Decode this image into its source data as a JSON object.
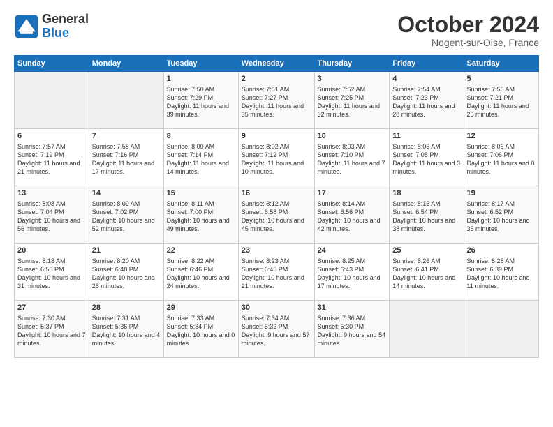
{
  "header": {
    "logo_line1": "General",
    "logo_line2": "Blue",
    "month": "October 2024",
    "location": "Nogent-sur-Oise, France"
  },
  "columns": [
    "Sunday",
    "Monday",
    "Tuesday",
    "Wednesday",
    "Thursday",
    "Friday",
    "Saturday"
  ],
  "rows": [
    [
      {
        "day": "",
        "info": ""
      },
      {
        "day": "",
        "info": ""
      },
      {
        "day": "1",
        "info": "Sunrise: 7:50 AM\nSunset: 7:29 PM\nDaylight: 11 hours and 39 minutes."
      },
      {
        "day": "2",
        "info": "Sunrise: 7:51 AM\nSunset: 7:27 PM\nDaylight: 11 hours and 35 minutes."
      },
      {
        "day": "3",
        "info": "Sunrise: 7:52 AM\nSunset: 7:25 PM\nDaylight: 11 hours and 32 minutes."
      },
      {
        "day": "4",
        "info": "Sunrise: 7:54 AM\nSunset: 7:23 PM\nDaylight: 11 hours and 28 minutes."
      },
      {
        "day": "5",
        "info": "Sunrise: 7:55 AM\nSunset: 7:21 PM\nDaylight: 11 hours and 25 minutes."
      }
    ],
    [
      {
        "day": "6",
        "info": "Sunrise: 7:57 AM\nSunset: 7:19 PM\nDaylight: 11 hours and 21 minutes."
      },
      {
        "day": "7",
        "info": "Sunrise: 7:58 AM\nSunset: 7:16 PM\nDaylight: 11 hours and 17 minutes."
      },
      {
        "day": "8",
        "info": "Sunrise: 8:00 AM\nSunset: 7:14 PM\nDaylight: 11 hours and 14 minutes."
      },
      {
        "day": "9",
        "info": "Sunrise: 8:02 AM\nSunset: 7:12 PM\nDaylight: 11 hours and 10 minutes."
      },
      {
        "day": "10",
        "info": "Sunrise: 8:03 AM\nSunset: 7:10 PM\nDaylight: 11 hours and 7 minutes."
      },
      {
        "day": "11",
        "info": "Sunrise: 8:05 AM\nSunset: 7:08 PM\nDaylight: 11 hours and 3 minutes."
      },
      {
        "day": "12",
        "info": "Sunrise: 8:06 AM\nSunset: 7:06 PM\nDaylight: 11 hours and 0 minutes."
      }
    ],
    [
      {
        "day": "13",
        "info": "Sunrise: 8:08 AM\nSunset: 7:04 PM\nDaylight: 10 hours and 56 minutes."
      },
      {
        "day": "14",
        "info": "Sunrise: 8:09 AM\nSunset: 7:02 PM\nDaylight: 10 hours and 52 minutes."
      },
      {
        "day": "15",
        "info": "Sunrise: 8:11 AM\nSunset: 7:00 PM\nDaylight: 10 hours and 49 minutes."
      },
      {
        "day": "16",
        "info": "Sunrise: 8:12 AM\nSunset: 6:58 PM\nDaylight: 10 hours and 45 minutes."
      },
      {
        "day": "17",
        "info": "Sunrise: 8:14 AM\nSunset: 6:56 PM\nDaylight: 10 hours and 42 minutes."
      },
      {
        "day": "18",
        "info": "Sunrise: 8:15 AM\nSunset: 6:54 PM\nDaylight: 10 hours and 38 minutes."
      },
      {
        "day": "19",
        "info": "Sunrise: 8:17 AM\nSunset: 6:52 PM\nDaylight: 10 hours and 35 minutes."
      }
    ],
    [
      {
        "day": "20",
        "info": "Sunrise: 8:18 AM\nSunset: 6:50 PM\nDaylight: 10 hours and 31 minutes."
      },
      {
        "day": "21",
        "info": "Sunrise: 8:20 AM\nSunset: 6:48 PM\nDaylight: 10 hours and 28 minutes."
      },
      {
        "day": "22",
        "info": "Sunrise: 8:22 AM\nSunset: 6:46 PM\nDaylight: 10 hours and 24 minutes."
      },
      {
        "day": "23",
        "info": "Sunrise: 8:23 AM\nSunset: 6:45 PM\nDaylight: 10 hours and 21 minutes."
      },
      {
        "day": "24",
        "info": "Sunrise: 8:25 AM\nSunset: 6:43 PM\nDaylight: 10 hours and 17 minutes."
      },
      {
        "day": "25",
        "info": "Sunrise: 8:26 AM\nSunset: 6:41 PM\nDaylight: 10 hours and 14 minutes."
      },
      {
        "day": "26",
        "info": "Sunrise: 8:28 AM\nSunset: 6:39 PM\nDaylight: 10 hours and 11 minutes."
      }
    ],
    [
      {
        "day": "27",
        "info": "Sunrise: 7:30 AM\nSunset: 5:37 PM\nDaylight: 10 hours and 7 minutes."
      },
      {
        "day": "28",
        "info": "Sunrise: 7:31 AM\nSunset: 5:36 PM\nDaylight: 10 hours and 4 minutes."
      },
      {
        "day": "29",
        "info": "Sunrise: 7:33 AM\nSunset: 5:34 PM\nDaylight: 10 hours and 0 minutes."
      },
      {
        "day": "30",
        "info": "Sunrise: 7:34 AM\nSunset: 5:32 PM\nDaylight: 9 hours and 57 minutes."
      },
      {
        "day": "31",
        "info": "Sunrise: 7:36 AM\nSunset: 5:30 PM\nDaylight: 9 hours and 54 minutes."
      },
      {
        "day": "",
        "info": ""
      },
      {
        "day": "",
        "info": ""
      }
    ]
  ]
}
